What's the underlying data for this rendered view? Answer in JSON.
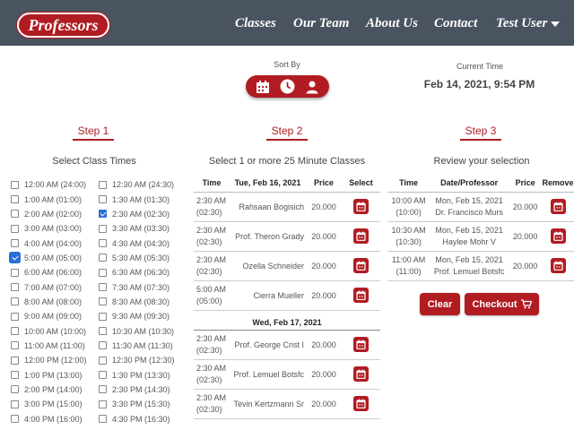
{
  "nav": {
    "brand": "Professors",
    "items": [
      "Classes",
      "Our Team",
      "About Us",
      "Contact"
    ],
    "user": "Test User"
  },
  "sort": {
    "label": "Sort By",
    "icons": [
      "calendar-icon",
      "clock-icon",
      "user-icon"
    ]
  },
  "current_time": {
    "label": "Current Time",
    "value": "Feb 14, 2021, 9:54 PM"
  },
  "step1": {
    "title": "Step 1",
    "subtitle": "Select Class Times",
    "times": [
      [
        "12:00 AM (24:00)",
        "12:30 AM (24:30)"
      ],
      [
        "1:00 AM (01:00)",
        "1:30 AM (01:30)"
      ],
      [
        "2:00 AM (02:00)",
        "2:30 AM (02:30)"
      ],
      [
        "3:00 AM (03:00)",
        "3:30 AM (03:30)"
      ],
      [
        "4:00 AM (04:00)",
        "4:30 AM (04:30)"
      ],
      [
        "5:00 AM (05:00)",
        "5:30 AM (05:30)"
      ],
      [
        "6:00 AM (06:00)",
        "6:30 AM (06:30)"
      ],
      [
        "7:00 AM (07:00)",
        "7:30 AM (07:30)"
      ],
      [
        "8:00 AM (08:00)",
        "8:30 AM (08:30)"
      ],
      [
        "9:00 AM (09:00)",
        "9:30 AM (09:30)"
      ],
      [
        "10:00 AM (10:00)",
        "10:30 AM (10:30)"
      ],
      [
        "11:00 AM (11:00)",
        "11:30 AM (11:30)"
      ],
      [
        "12:00 PM (12:00)",
        "12:30 PM (12:30)"
      ],
      [
        "1:00 PM (13:00)",
        "1:30 PM (13:30)"
      ],
      [
        "2:00 PM (14:00)",
        "2:30 PM (14:30)"
      ],
      [
        "3:00 PM (15:00)",
        "3:30 PM (15:30)"
      ],
      [
        "4:00 PM (16:00)",
        "4:30 PM (16:30)"
      ]
    ],
    "checked": [
      [
        "2",
        1
      ],
      [
        "5",
        0
      ]
    ]
  },
  "step2": {
    "title": "Step 2",
    "subtitle": "Select 1 or more 25 Minute Classes",
    "headers": [
      "Time",
      "Tue, Feb 16, 2021",
      "Price",
      "Select"
    ],
    "groups": [
      {
        "date": "",
        "rows": [
          {
            "time": "2:30 AM",
            "time24": "(02:30)",
            "prof": "Rahsaan Bogisich",
            "price": "20.000"
          },
          {
            "time": "2:30 AM",
            "time24": "(02:30)",
            "prof": "Prof. Theron Grady",
            "price": "20.000"
          },
          {
            "time": "2:30 AM",
            "time24": "(02:30)",
            "prof": "Ozella Schneider",
            "price": "20.000"
          },
          {
            "time": "5:00 AM",
            "time24": "(05:00)",
            "prof": "Cierra Mueller",
            "price": "20.000"
          }
        ]
      },
      {
        "date": "Wed, Feb 17, 2021",
        "rows": [
          {
            "time": "2:30 AM",
            "time24": "(02:30)",
            "prof": "Prof. George Crist I",
            "price": "20.000"
          },
          {
            "time": "2:30 AM",
            "time24": "(02:30)",
            "prof": "Prof. Lemuel Botsfc",
            "price": "20.000"
          },
          {
            "time": "2:30 AM",
            "time24": "(02:30)",
            "prof": "Tevin Kertzmann Sr",
            "price": "20.000"
          }
        ]
      }
    ]
  },
  "step3": {
    "title": "Step 3",
    "subtitle": "Review your selection",
    "headers": [
      "Time",
      "Date/Professor",
      "Price",
      "Remove"
    ],
    "rows": [
      {
        "time": "10:00 AM",
        "time24": "(10:00)",
        "date": "Mon, Feb 15, 2021",
        "prof": "Dr. Francisco Murs",
        "price": "20.000"
      },
      {
        "time": "10:30 AM",
        "time24": "(10:30)",
        "date": "Mon, Feb 15, 2021",
        "prof": "Haylee Mohr V",
        "price": "20.000"
      },
      {
        "time": "11:00 AM",
        "time24": "(11:00)",
        "date": "Mon, Feb 15, 2021",
        "prof": "Prof. Lemuel Botsfc",
        "price": "20.000"
      }
    ],
    "clear_label": "Clear",
    "checkout_label": "Checkout"
  },
  "colors": {
    "accent": "#b01c22",
    "nav_bg": "#4a5360",
    "check": "#2a6fd6"
  }
}
